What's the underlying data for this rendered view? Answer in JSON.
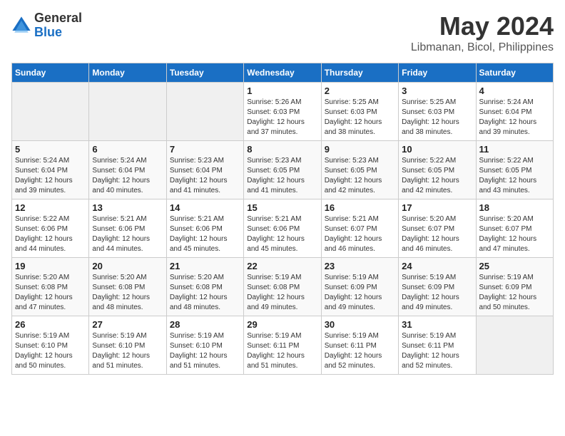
{
  "header": {
    "logo_general": "General",
    "logo_blue": "Blue",
    "title": "May 2024",
    "subtitle": "Libmanan, Bicol, Philippines"
  },
  "weekdays": [
    "Sunday",
    "Monday",
    "Tuesday",
    "Wednesday",
    "Thursday",
    "Friday",
    "Saturday"
  ],
  "weeks": [
    [
      {
        "day": "",
        "empty": true
      },
      {
        "day": "",
        "empty": true
      },
      {
        "day": "",
        "empty": true
      },
      {
        "day": "1",
        "sunrise": "Sunrise: 5:26 AM",
        "sunset": "Sunset: 6:03 PM",
        "daylight": "Daylight: 12 hours and 37 minutes."
      },
      {
        "day": "2",
        "sunrise": "Sunrise: 5:25 AM",
        "sunset": "Sunset: 6:03 PM",
        "daylight": "Daylight: 12 hours and 38 minutes."
      },
      {
        "day": "3",
        "sunrise": "Sunrise: 5:25 AM",
        "sunset": "Sunset: 6:03 PM",
        "daylight": "Daylight: 12 hours and 38 minutes."
      },
      {
        "day": "4",
        "sunrise": "Sunrise: 5:24 AM",
        "sunset": "Sunset: 6:04 PM",
        "daylight": "Daylight: 12 hours and 39 minutes."
      }
    ],
    [
      {
        "day": "5",
        "sunrise": "Sunrise: 5:24 AM",
        "sunset": "Sunset: 6:04 PM",
        "daylight": "Daylight: 12 hours and 39 minutes."
      },
      {
        "day": "6",
        "sunrise": "Sunrise: 5:24 AM",
        "sunset": "Sunset: 6:04 PM",
        "daylight": "Daylight: 12 hours and 40 minutes."
      },
      {
        "day": "7",
        "sunrise": "Sunrise: 5:23 AM",
        "sunset": "Sunset: 6:04 PM",
        "daylight": "Daylight: 12 hours and 41 minutes."
      },
      {
        "day": "8",
        "sunrise": "Sunrise: 5:23 AM",
        "sunset": "Sunset: 6:05 PM",
        "daylight": "Daylight: 12 hours and 41 minutes."
      },
      {
        "day": "9",
        "sunrise": "Sunrise: 5:23 AM",
        "sunset": "Sunset: 6:05 PM",
        "daylight": "Daylight: 12 hours and 42 minutes."
      },
      {
        "day": "10",
        "sunrise": "Sunrise: 5:22 AM",
        "sunset": "Sunset: 6:05 PM",
        "daylight": "Daylight: 12 hours and 42 minutes."
      },
      {
        "day": "11",
        "sunrise": "Sunrise: 5:22 AM",
        "sunset": "Sunset: 6:05 PM",
        "daylight": "Daylight: 12 hours and 43 minutes."
      }
    ],
    [
      {
        "day": "12",
        "sunrise": "Sunrise: 5:22 AM",
        "sunset": "Sunset: 6:06 PM",
        "daylight": "Daylight: 12 hours and 44 minutes."
      },
      {
        "day": "13",
        "sunrise": "Sunrise: 5:21 AM",
        "sunset": "Sunset: 6:06 PM",
        "daylight": "Daylight: 12 hours and 44 minutes."
      },
      {
        "day": "14",
        "sunrise": "Sunrise: 5:21 AM",
        "sunset": "Sunset: 6:06 PM",
        "daylight": "Daylight: 12 hours and 45 minutes."
      },
      {
        "day": "15",
        "sunrise": "Sunrise: 5:21 AM",
        "sunset": "Sunset: 6:06 PM",
        "daylight": "Daylight: 12 hours and 45 minutes."
      },
      {
        "day": "16",
        "sunrise": "Sunrise: 5:21 AM",
        "sunset": "Sunset: 6:07 PM",
        "daylight": "Daylight: 12 hours and 46 minutes."
      },
      {
        "day": "17",
        "sunrise": "Sunrise: 5:20 AM",
        "sunset": "Sunset: 6:07 PM",
        "daylight": "Daylight: 12 hours and 46 minutes."
      },
      {
        "day": "18",
        "sunrise": "Sunrise: 5:20 AM",
        "sunset": "Sunset: 6:07 PM",
        "daylight": "Daylight: 12 hours and 47 minutes."
      }
    ],
    [
      {
        "day": "19",
        "sunrise": "Sunrise: 5:20 AM",
        "sunset": "Sunset: 6:08 PM",
        "daylight": "Daylight: 12 hours and 47 minutes."
      },
      {
        "day": "20",
        "sunrise": "Sunrise: 5:20 AM",
        "sunset": "Sunset: 6:08 PM",
        "daylight": "Daylight: 12 hours and 48 minutes."
      },
      {
        "day": "21",
        "sunrise": "Sunrise: 5:20 AM",
        "sunset": "Sunset: 6:08 PM",
        "daylight": "Daylight: 12 hours and 48 minutes."
      },
      {
        "day": "22",
        "sunrise": "Sunrise: 5:19 AM",
        "sunset": "Sunset: 6:08 PM",
        "daylight": "Daylight: 12 hours and 49 minutes."
      },
      {
        "day": "23",
        "sunrise": "Sunrise: 5:19 AM",
        "sunset": "Sunset: 6:09 PM",
        "daylight": "Daylight: 12 hours and 49 minutes."
      },
      {
        "day": "24",
        "sunrise": "Sunrise: 5:19 AM",
        "sunset": "Sunset: 6:09 PM",
        "daylight": "Daylight: 12 hours and 49 minutes."
      },
      {
        "day": "25",
        "sunrise": "Sunrise: 5:19 AM",
        "sunset": "Sunset: 6:09 PM",
        "daylight": "Daylight: 12 hours and 50 minutes."
      }
    ],
    [
      {
        "day": "26",
        "sunrise": "Sunrise: 5:19 AM",
        "sunset": "Sunset: 6:10 PM",
        "daylight": "Daylight: 12 hours and 50 minutes."
      },
      {
        "day": "27",
        "sunrise": "Sunrise: 5:19 AM",
        "sunset": "Sunset: 6:10 PM",
        "daylight": "Daylight: 12 hours and 51 minutes."
      },
      {
        "day": "28",
        "sunrise": "Sunrise: 5:19 AM",
        "sunset": "Sunset: 6:10 PM",
        "daylight": "Daylight: 12 hours and 51 minutes."
      },
      {
        "day": "29",
        "sunrise": "Sunrise: 5:19 AM",
        "sunset": "Sunset: 6:11 PM",
        "daylight": "Daylight: 12 hours and 51 minutes."
      },
      {
        "day": "30",
        "sunrise": "Sunrise: 5:19 AM",
        "sunset": "Sunset: 6:11 PM",
        "daylight": "Daylight: 12 hours and 52 minutes."
      },
      {
        "day": "31",
        "sunrise": "Sunrise: 5:19 AM",
        "sunset": "Sunset: 6:11 PM",
        "daylight": "Daylight: 12 hours and 52 minutes."
      },
      {
        "day": "",
        "empty": true
      }
    ]
  ]
}
